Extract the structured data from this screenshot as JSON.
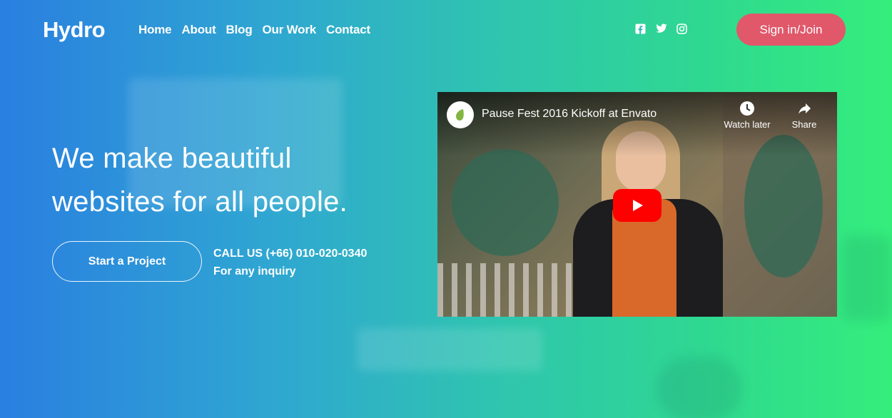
{
  "brand": {
    "logo": "Hydro"
  },
  "nav": {
    "items": [
      "Home",
      "About",
      "Blog",
      "Our Work",
      "Contact"
    ]
  },
  "social": {
    "icons": [
      "facebook-icon",
      "twitter-icon",
      "instagram-icon"
    ]
  },
  "header": {
    "signin_label": "Sign in/Join"
  },
  "hero": {
    "headline_line1": "We make beautiful",
    "headline_line2": "websites for all people.",
    "cta_label": "Start a Project",
    "contact_line1": "CALL US (+66) 010-020-0340",
    "contact_line2": "For any inquiry"
  },
  "video": {
    "title": "Pause Fest 2016 Kickoff at Envato",
    "watch_later_label": "Watch later",
    "share_label": "Share"
  },
  "colors": {
    "gradient_start": "#2a7fe0",
    "gradient_end": "#34ee7c",
    "signin_button": "#e0586a",
    "play_button": "#ff0000"
  }
}
